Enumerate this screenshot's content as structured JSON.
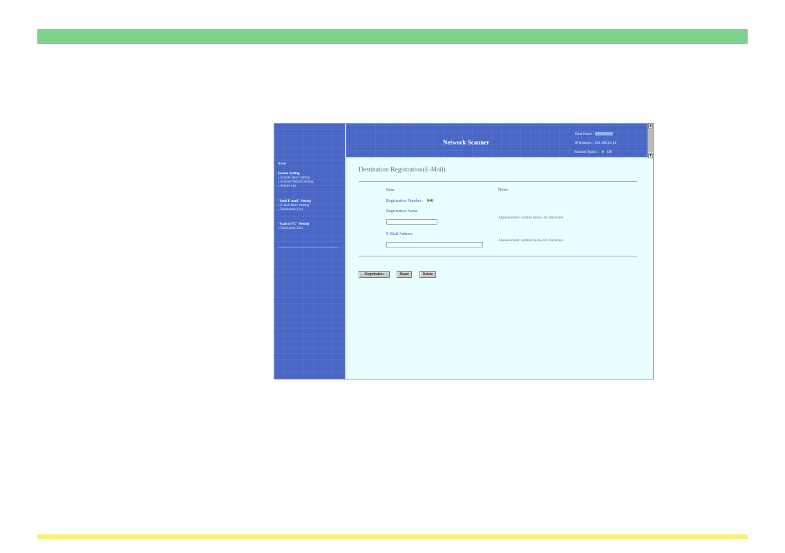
{
  "header": {
    "title": "Network Scanner",
    "host_name_label": "Host Name :",
    "ip_label": "IP Address :",
    "ip_value": "192.168.10.14",
    "status_label": "Scanner Status :",
    "status_value": "OK",
    "status_color": "#7cff4a"
  },
  "sidebar": {
    "home": "Home",
    "groups": [
      {
        "heading": "System Setting",
        "items": [
          "» System Basic Setting",
          "» Scanner Default Setting",
          "» Sender List"
        ]
      },
      {
        "heading": "\"Send E-mail\" Setting",
        "items": [
          "» E-mail Basic Setting",
          "» Destination List"
        ]
      },
      {
        "heading": "\"Scan to PC\" Setting",
        "items": [
          "» Destination List"
        ]
      }
    ]
  },
  "main": {
    "page_title": "Destination Registration(E-Mail)",
    "col_item": "Item",
    "col_notes": "Notes",
    "reg_number_label": "Registration Number :",
    "reg_number_value": "048",
    "reg_name_label": "Registration Name",
    "reg_name_value": "",
    "reg_name_note": "Alphanumeric symbol below 16 characters",
    "email_label": "E-Mail Address",
    "email_value": "",
    "email_note": "Alphanumeric symbol below 64 characters"
  },
  "buttons": {
    "registration": "Registration",
    "reset": "Reset",
    "delete": "Delete"
  },
  "colors": {
    "top_band": "#7fd18c",
    "bottom_band": "#f8f27a",
    "nav_blue": "#4a67c6",
    "content_bg": "#e9ffff"
  }
}
